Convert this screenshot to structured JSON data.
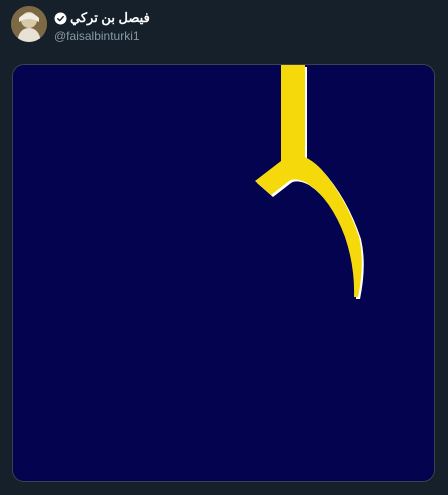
{
  "tweet": {
    "author": {
      "display_name": "فيصل بن تركي",
      "handle": "@faisalbinturki1",
      "verified": true,
      "verified_icon": "verified-badge-icon",
      "avatar_icon": "avatar-photo"
    },
    "media": {
      "type": "animated-gif",
      "background_color": "#03034f",
      "glyph_color": "#f5d90a",
      "glyph_outline_color": "#ffffff"
    }
  },
  "colors": {
    "page_background": "#15202b",
    "name_text": "#ffffff",
    "handle_text": "#8899a6",
    "media_border": "#38444d"
  }
}
